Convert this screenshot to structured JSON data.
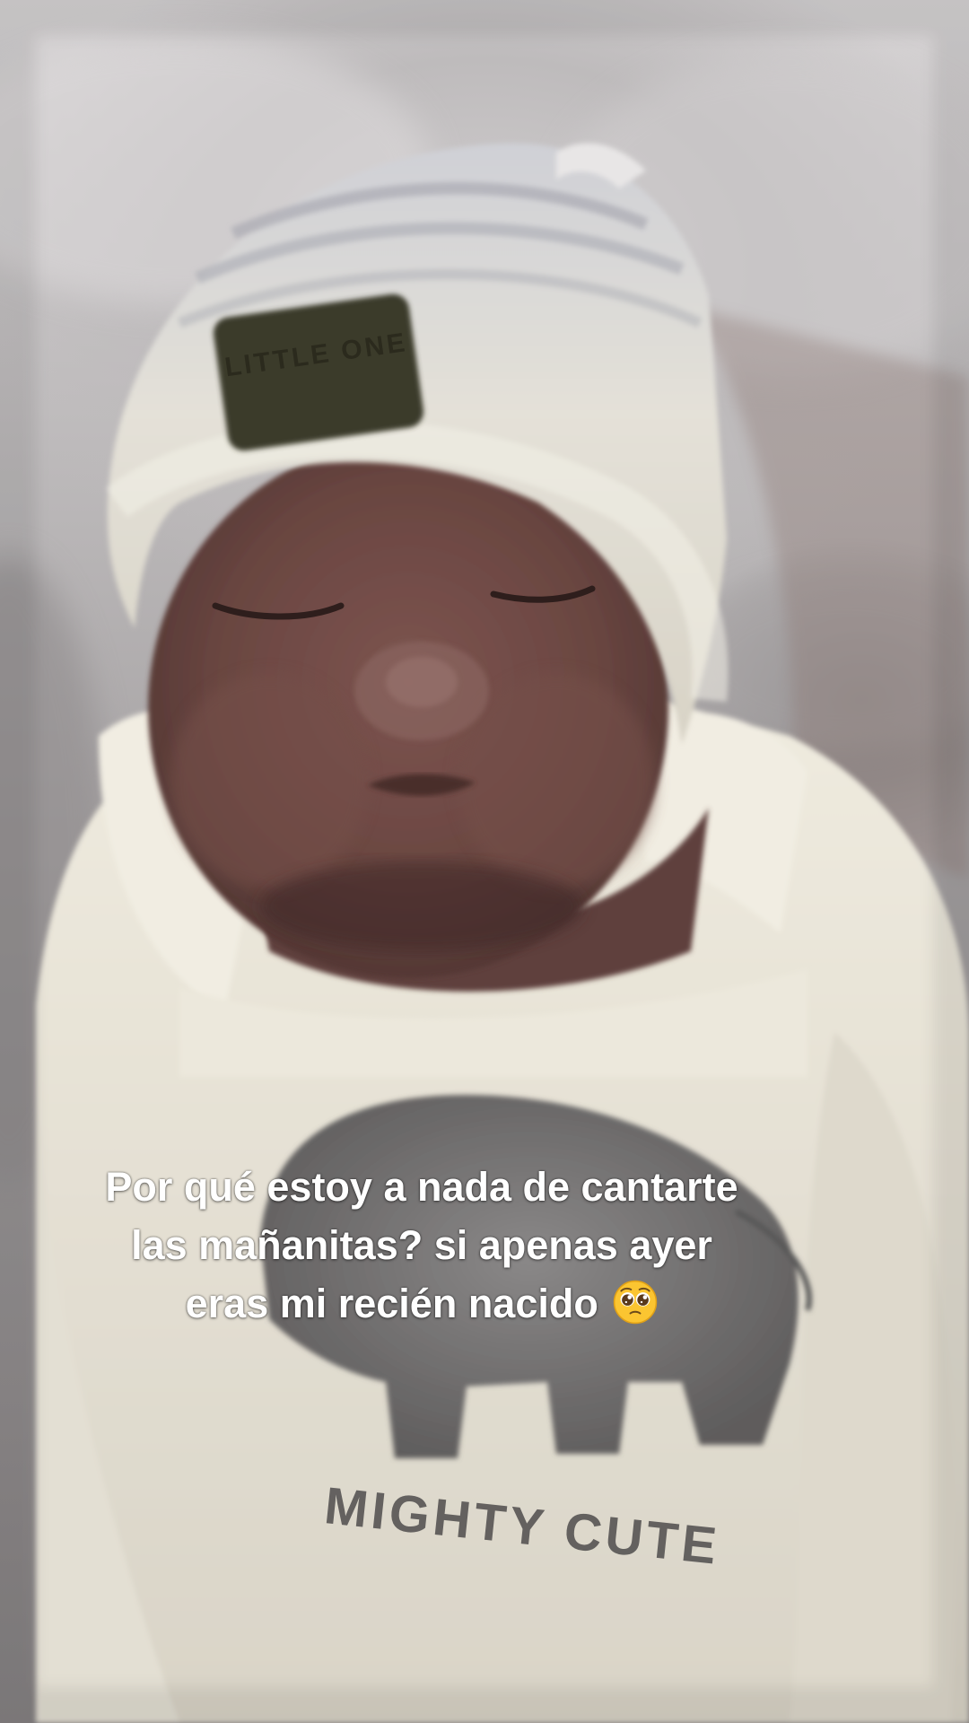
{
  "caption": {
    "text": "Por qué estoy a nada de cantarte las mañanitas? si apenas ayer eras mi recién nacido",
    "emoji": "pleading-face-icon"
  },
  "photo": {
    "hat_patch_text": "LITTLE ONE",
    "onesie_text": "MIGHTY CUTE"
  },
  "colors": {
    "caption_text": "#ffffff",
    "hat": "#ece8dc",
    "onesie": "#e9e5d8",
    "skin": "#6f4a45",
    "blanket": "#bdbabb"
  }
}
